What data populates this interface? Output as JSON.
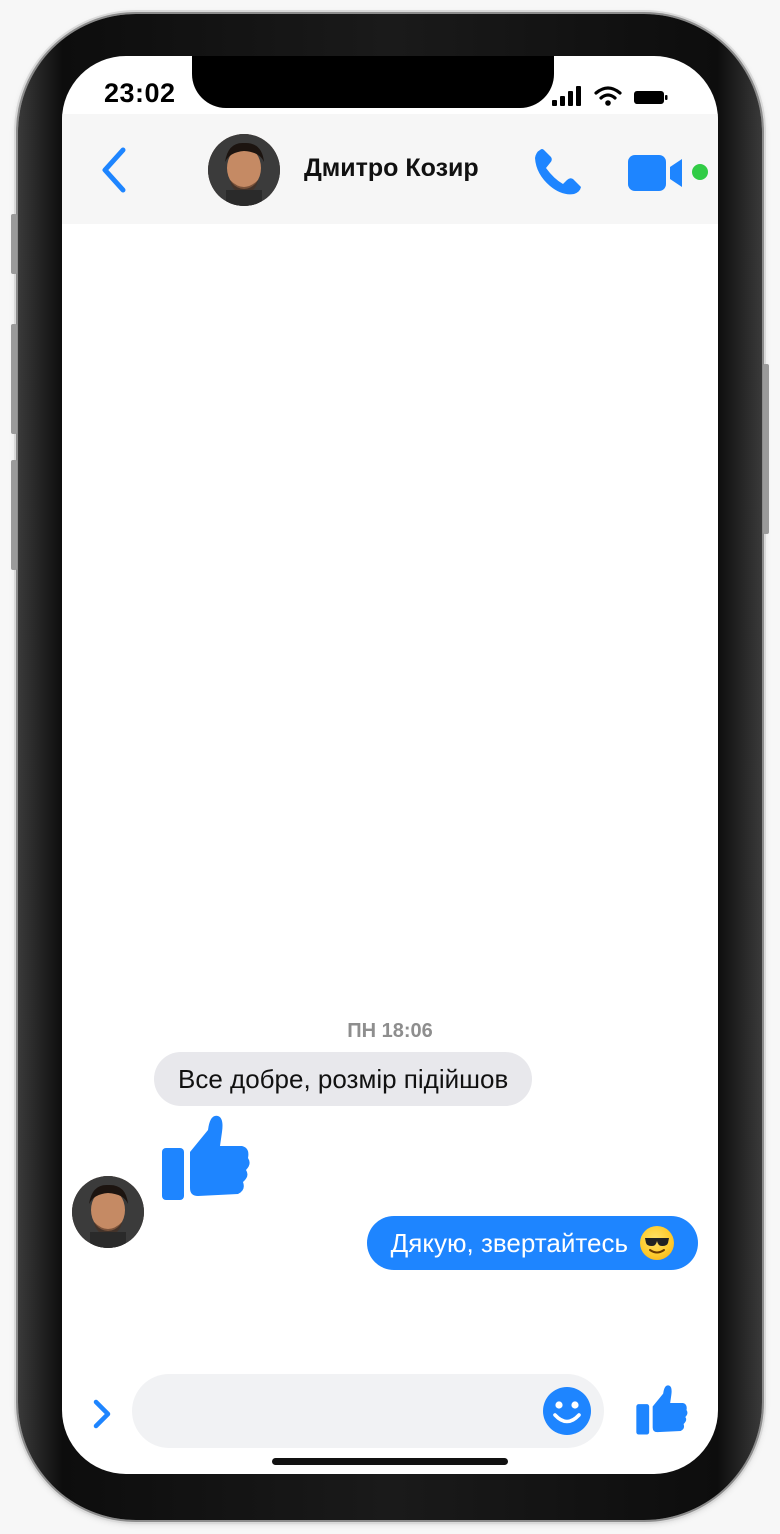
{
  "status_bar": {
    "time": "23:02"
  },
  "header": {
    "contact_name": "Дмитро Козир",
    "online": true,
    "icons": {
      "back": "chevron-left-icon",
      "call": "phone-icon",
      "video": "video-camera-icon"
    }
  },
  "conversation": {
    "timestamp": "ПН 18:06",
    "messages": [
      {
        "direction": "incoming",
        "text": "Все добре, розмір підійшов"
      },
      {
        "direction": "incoming",
        "sticker": "thumbs-up-icon"
      },
      {
        "direction": "outgoing",
        "text": "Дякую, звертайтесь",
        "emoji": "smiling-face-with-sunglasses"
      }
    ]
  },
  "composer": {
    "placeholder": "",
    "icons": {
      "expand": "chevron-right-icon",
      "emoji": "smiley-icon",
      "like": "thumbs-up-icon"
    }
  },
  "colors": {
    "accent": "#1e85ff",
    "incoming_bubble": "#e8e8ec",
    "online": "#31cc46"
  }
}
